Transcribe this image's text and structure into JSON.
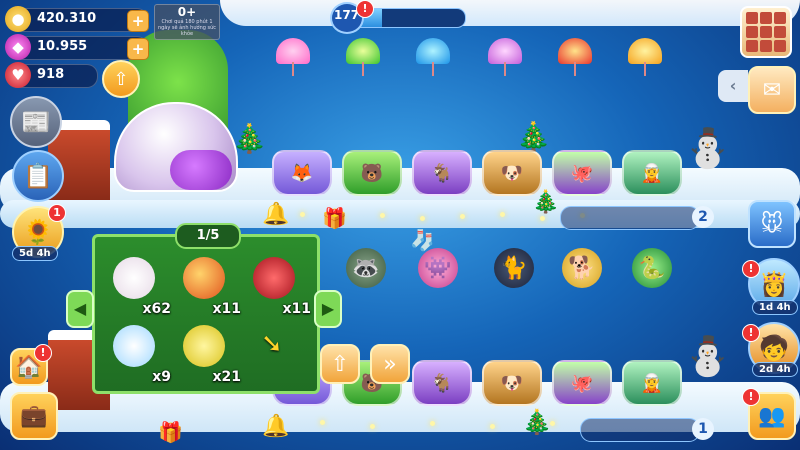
{
  "resources": {
    "coins": "420.310",
    "gems": "10.955",
    "hearts": "918"
  },
  "quest_tooltip": {
    "count": "0+",
    "text": "Chơi quả 180 phút 1 ngày sẽ ảnh hưởng sức khỏe"
  },
  "level": {
    "value": "177",
    "progress": 0.35
  },
  "left_event": {
    "badge": "1",
    "timer": "5d 4h"
  },
  "panel": {
    "page": "1/5",
    "items": [
      {
        "name": "cotton",
        "qty": "x62"
      },
      {
        "name": "fruit",
        "qty": "x11"
      },
      {
        "name": "rose",
        "qty": "x11"
      },
      {
        "name": "snowflake",
        "qty": "x9"
      },
      {
        "name": "bell-pepper",
        "qty": "x21"
      }
    ]
  },
  "right_events": [
    {
      "timer": "1d 4h",
      "badge": "!"
    },
    {
      "timer": "2d 4h",
      "badge": "!"
    }
  ],
  "row_numbers": [
    "2",
    "1"
  ],
  "colors": {
    "accent": "#f9b84a",
    "panel_green": "#2c8d2c",
    "sky": "#1565b8"
  },
  "icons": {
    "coin": "coin-icon",
    "gem": "gem-icon",
    "heart": "heart-icon",
    "mail": "mail-icon",
    "menu": "grid-menu-icon"
  }
}
